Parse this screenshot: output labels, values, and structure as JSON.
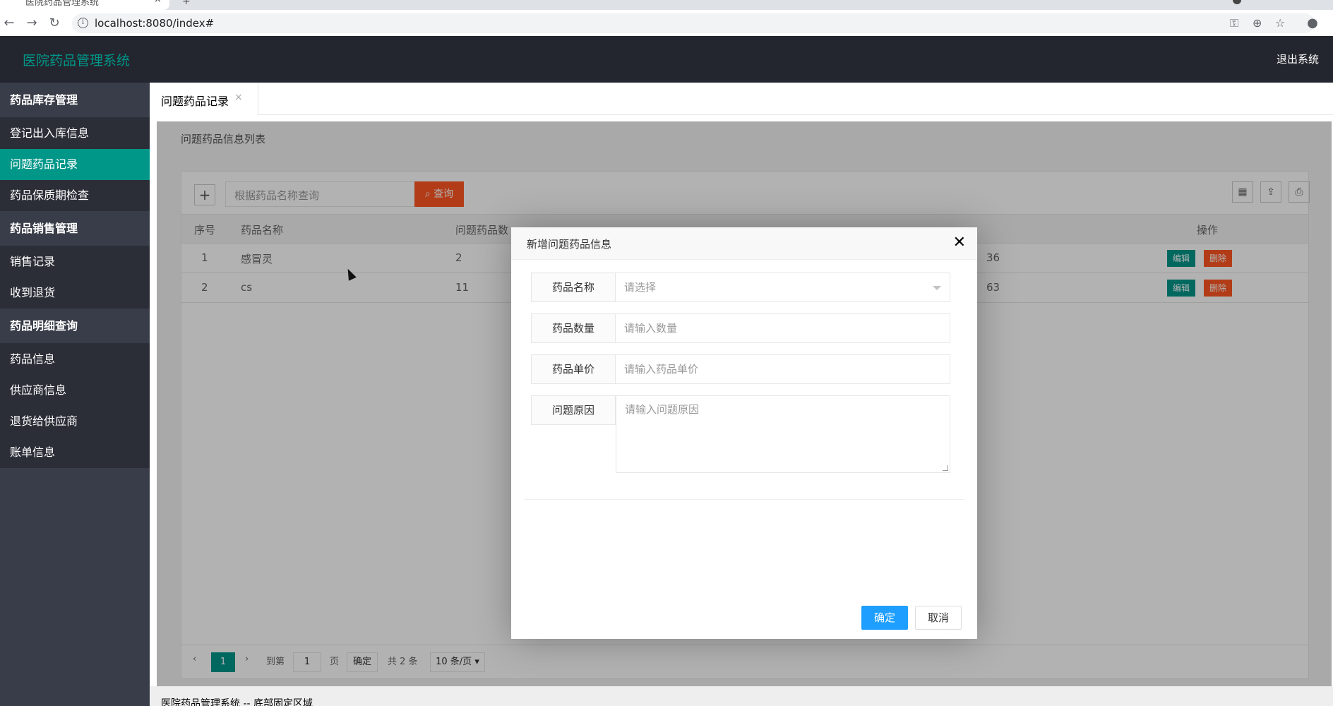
{
  "browser": {
    "tab_title": "医院药品管理系统",
    "tab_close": "×",
    "new_tab": "+",
    "url": "localhost:8080/index#",
    "icons": [
      "back-icon",
      "forward-icon",
      "reload-icon",
      "info-icon",
      "key-icon",
      "zoom-icon",
      "star-icon",
      "profile-icon"
    ]
  },
  "header": {
    "logo": "医院药品管理系统",
    "logout": "退出系统"
  },
  "sidebar": {
    "groups": [
      {
        "label": "药品库存管理",
        "items": [
          "登记出入库信息",
          "问题药品记录",
          "药品保质期检查"
        ]
      },
      {
        "label": "药品销售管理",
        "items": [
          "销售记录",
          "收到退货"
        ]
      },
      {
        "label": "药品明细查询",
        "items": [
          "药品信息",
          "供应商信息",
          "退货给供应商",
          "账单信息"
        ]
      }
    ],
    "active_item": "问题药品记录"
  },
  "tabs": {
    "current": "问题药品记录",
    "close": "×"
  },
  "page": {
    "list_title": "问题药品信息列表",
    "search_placeholder": "根据药品名称查询",
    "query_button": "查询",
    "add_button": "+",
    "columns": [
      "序号",
      "药品名称",
      "问题药品数",
      "操作"
    ],
    "rows": [
      {
        "no": "1",
        "name": "感冒灵",
        "qty": "2",
        "extra": "36",
        "edit": "编辑",
        "delete": "删除"
      },
      {
        "no": "2",
        "name": "cs",
        "qty": "11",
        "extra": "63",
        "edit": "编辑",
        "delete": "删除"
      }
    ],
    "pager": {
      "prev": "‹",
      "current_page": "1",
      "next": "›",
      "goto_label": "到第",
      "goto_value": "1",
      "page_unit": "页",
      "confirm": "确定",
      "total": "共 2 条",
      "page_size": "10 条/页"
    }
  },
  "footer": {
    "text": "医院药品管理系统 -- 底部固定区域"
  },
  "dialog": {
    "title": "新增问题药品信息",
    "close": "✕",
    "fields": [
      {
        "label": "药品名称",
        "placeholder": "请选择",
        "type": "select"
      },
      {
        "label": "药品数量",
        "placeholder": "请输入数量",
        "type": "input"
      },
      {
        "label": "药品单价",
        "placeholder": "请输入药品单价",
        "type": "input"
      },
      {
        "label": "问题原因",
        "placeholder": "请输入问题原因",
        "type": "textarea"
      }
    ],
    "ok": "确定",
    "cancel": "取消"
  },
  "colors": {
    "accent": "#009688",
    "header_bg": "#23262e",
    "sidebar_bg": "#393d49",
    "primary_button": "#1e9fff",
    "danger": "#ff5722"
  }
}
